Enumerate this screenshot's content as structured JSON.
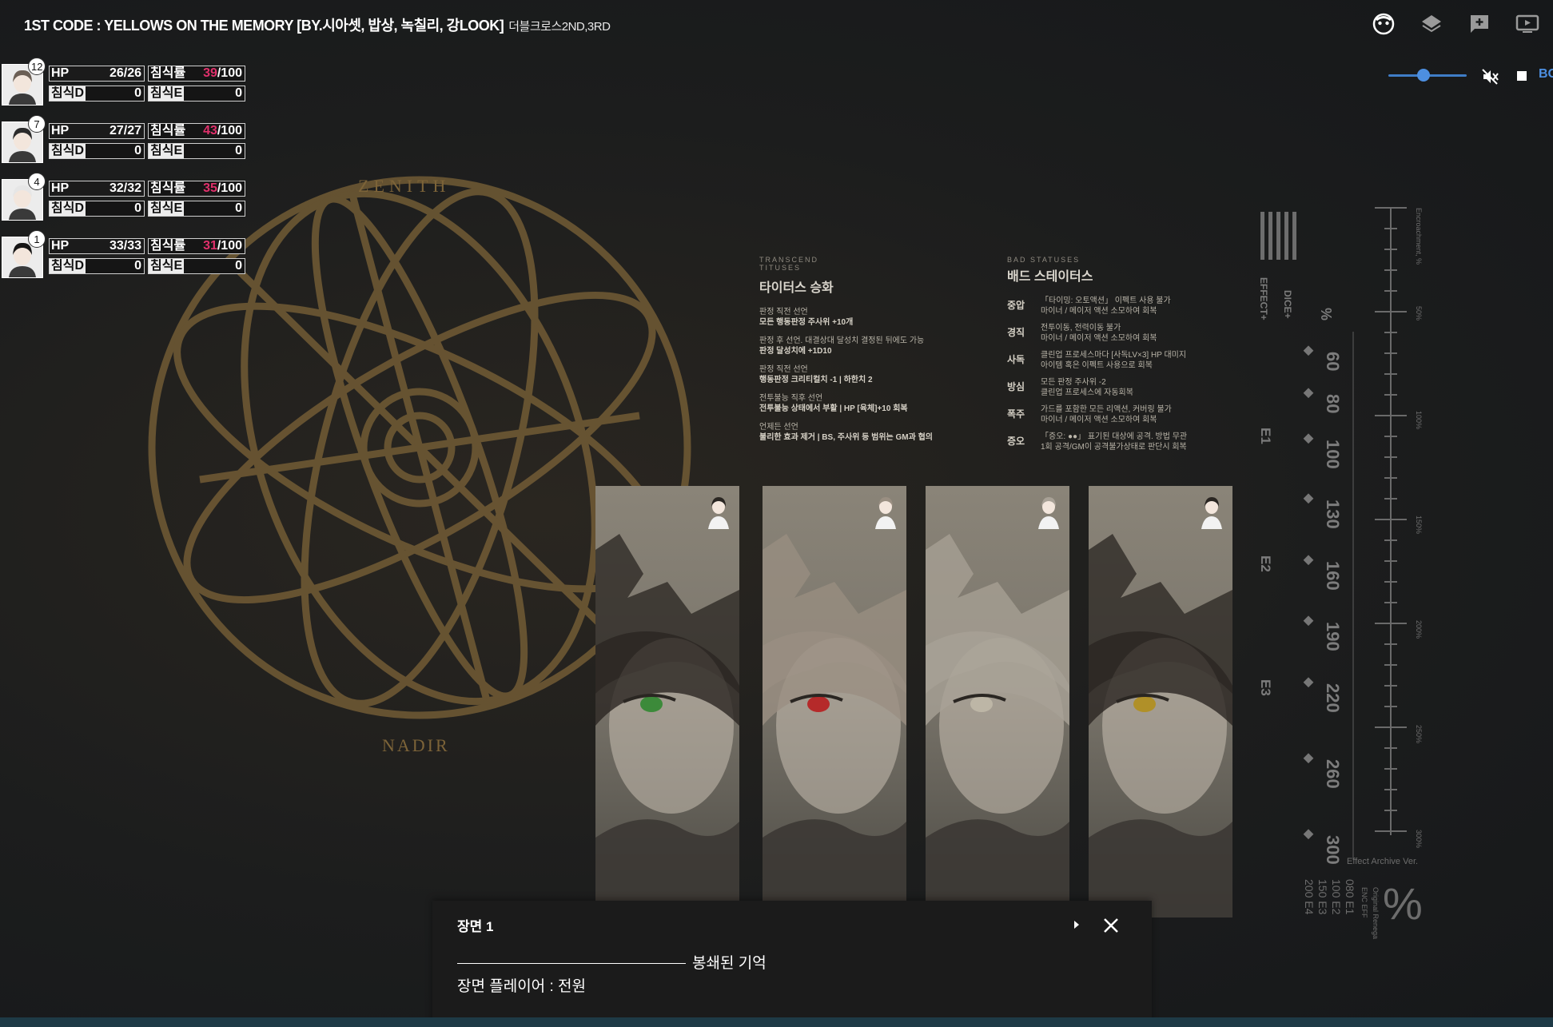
{
  "header": {
    "title": "1ST CODE : YELLOWS ON THE MEMORY [BY.시아셋, 밥상, 녹칠리, 강LOOK]",
    "subtitle": "더블크로스2ND,3RD",
    "icons": [
      "face-icon",
      "layers-icon",
      "add-comment-icon",
      "screen-icon"
    ]
  },
  "audio": {
    "volume_level": 0.45,
    "bg_label": "BG"
  },
  "characters": [
    {
      "badge": "12",
      "hp_label": "HP",
      "hp_value": "26/26",
      "erosion_label": "침식률",
      "erosion_value": "39",
      "erosion_max": "/100",
      "d_label": "침식D",
      "d_value": "0",
      "e_label": "침식E",
      "e_value": "0"
    },
    {
      "badge": "7",
      "hp_label": "HP",
      "hp_value": "27/27",
      "erosion_label": "침식률",
      "erosion_value": "43",
      "erosion_max": "/100",
      "d_label": "침식D",
      "d_value": "0",
      "e_label": "침식E",
      "e_value": "0"
    },
    {
      "badge": "4",
      "hp_label": "HP",
      "hp_value": "32/32",
      "erosion_label": "침식률",
      "erosion_value": "35",
      "erosion_max": "/100",
      "d_label": "침식D",
      "d_value": "0",
      "e_label": "침식E",
      "e_value": "0"
    },
    {
      "badge": "1",
      "hp_label": "HP",
      "hp_value": "33/33",
      "erosion_label": "침식률",
      "erosion_value": "31",
      "erosion_max": "/100",
      "d_label": "침식D",
      "d_value": "0",
      "e_label": "침식E",
      "e_value": "0"
    }
  ],
  "background_art": {
    "zenith": "ZENITH",
    "nadir": "NADIR"
  },
  "rules": {
    "transcend": {
      "tag1": "TRANSCEND",
      "tag2": "TITUSES",
      "title": "타이터스 승화",
      "items": [
        {
          "cond": "판정 직전 선언",
          "effect": "모든 행동판정 주사위 +10개"
        },
        {
          "cond": "판정 후 선언. 대결상대 달성치 결정된 뒤에도 가능",
          "effect": "판정 달성치에 +1D10"
        },
        {
          "cond": "판정 직전 선언",
          "effect": "행동판정 크리티컬치 -1 | 하한치 2"
        },
        {
          "cond": "전투불능 직후 선언",
          "effect": "전투불능 상태에서 부활 | HP [육체]+10 회복"
        },
        {
          "cond": "언제든 선언",
          "effect": "불리한 효과 제거 | BS, 주사위 등 범위는 GM과 협의"
        }
      ]
    },
    "bad_status": {
      "tag": "BAD STATUSES",
      "title": "배드 스테이터스",
      "items": [
        {
          "name": "중압",
          "l1": "「타이밍: 오토액션」 이펙트 사용 불가",
          "l2": "마이너 / 메이저 액션 소모하여 회복"
        },
        {
          "name": "경직",
          "l1": "전투이동, 전력이동 불가",
          "l2": "마이너 / 메이저 액션 소모하여 회복"
        },
        {
          "name": "사독",
          "l1": "클린업 프로세스마다 [사독LV×3] HP 대미지",
          "l2": "아이템 혹은 이펙트 사용으로 회복"
        },
        {
          "name": "방심",
          "l1": "모든 판정 주사위 -2",
          "l2": "클린업 프로세스에 자동회복"
        },
        {
          "name": "폭주",
          "l1": "가드를 포함한 모든 리액션, 커버링 불가",
          "l2": "마이너 / 메이저 액션 소모하여 회복"
        },
        {
          "name": "증오",
          "l1": "「증오: ●●」 표기된 대상에 공격. 방법 무관",
          "l2": "1회 공격/GM이 공격불가상태로 판단시 회복"
        }
      ]
    }
  },
  "cards": [
    {
      "eye_color": "#3c8a3a"
    },
    {
      "eye_color": "#b52a2a"
    },
    {
      "eye_color": "#bdb6a6"
    },
    {
      "eye_color": "#b09028"
    }
  ],
  "gauge": {
    "marks": [
      "60",
      "80",
      "100",
      "130",
      "160",
      "190",
      "220",
      "260",
      "300"
    ],
    "effect_labels": [
      "E1",
      "E2",
      "E3"
    ],
    "header_effect": "EFFECT+",
    "header_dice": "DICE+",
    "header_pct": "%",
    "side_title": "Encroachment, %",
    "side_ticks": [
      "50%",
      "100%",
      "150%",
      "200%",
      "250%",
      "300%"
    ],
    "archive": "Effect Archive Ver.",
    "legend_cols": [
      "200 E4",
      "150 E3",
      "100 E2",
      "080 E1"
    ],
    "legend_heads": [
      "ENC EFF",
      "Original Renegade"
    ],
    "pct_big": "%"
  },
  "dialog": {
    "title": "장면 1",
    "line1": "봉쇄된 기억",
    "line2": "장면 플레이어 : 전원"
  }
}
